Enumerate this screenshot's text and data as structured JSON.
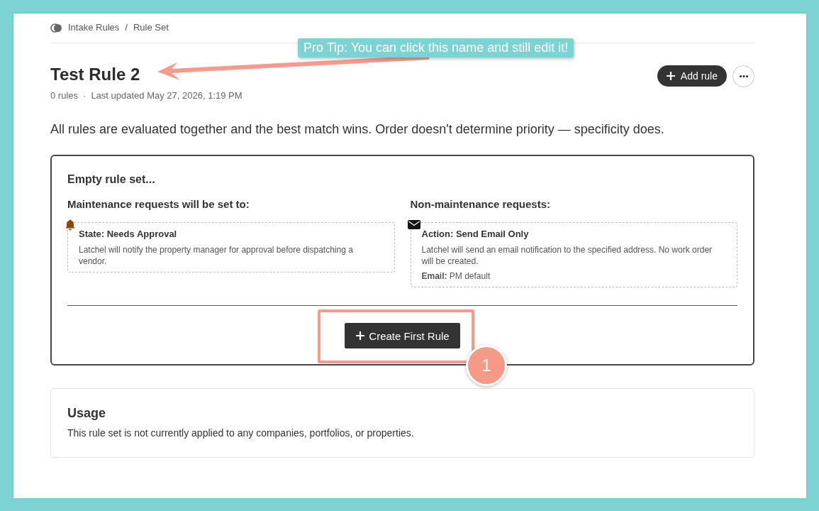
{
  "breadcrumb": {
    "items": [
      {
        "label": "Intake Rules"
      },
      {
        "label": "Rule Set"
      }
    ],
    "separator": "/"
  },
  "header": {
    "title": "Test Rule 2",
    "meta": [
      "0 rules",
      "Last updated May 27, 2026, 1:19 PM"
    ],
    "meta_separator": "·",
    "actions": [
      {
        "kind": "add",
        "label": "Add rule"
      },
      {
        "kind": "more"
      }
    ]
  },
  "description": "All rules are evaluated together and the best match wins. Order doesn't determine priority — specificity does.",
  "empty_card": {
    "title": "Empty rule set...",
    "columns": [
      {
        "heading": "Maintenance requests will be set to:",
        "outcome": {
          "kind": "state",
          "title": "State: Needs Approval",
          "text": "Latchel will notify the property manager for approval before dispatching a vendor."
        }
      },
      {
        "heading": "Non-maintenance requests:",
        "outcome": {
          "kind": "action",
          "title": "Action: Send Email Only",
          "text": "Latchel will send an email notification to the specified address. No work order will be created.",
          "details": [
            "**Email:** PM default"
          ]
        }
      }
    ],
    "button": {
      "label": "Create First Rule"
    }
  },
  "usage": {
    "title": "Usage",
    "text": "This rule set is not currently applied to any companies, portfolios, or properties."
  },
  "annotations": {
    "tip": "Pro Tip: You can click this name and still edit it!",
    "step": "1"
  }
}
